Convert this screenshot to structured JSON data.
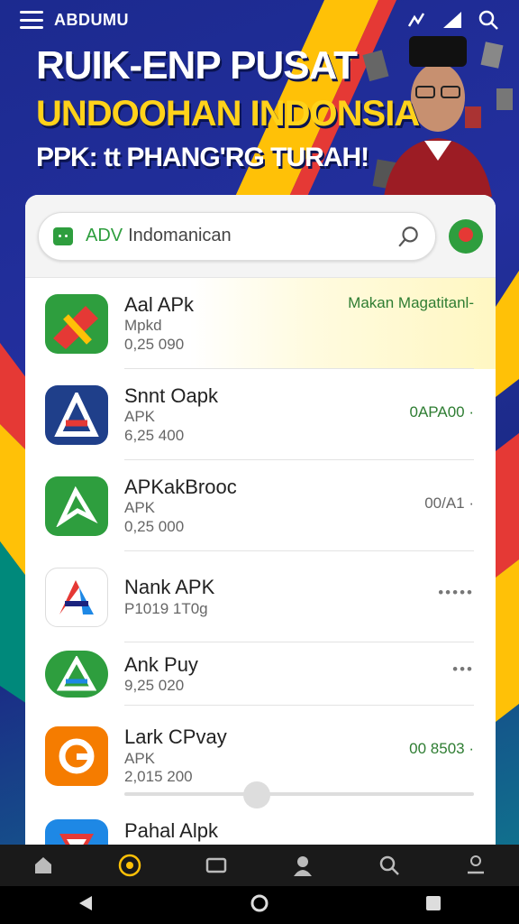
{
  "header": {
    "brand": "ABDUMU",
    "headline_1": "RUIK-ENP PUSAT",
    "headline_2": "UNDOOHAN INDONSIA",
    "headline_3": "PPK: tt PHANG'RG TURAH!"
  },
  "search": {
    "prefix": "ADV",
    "value": "Indomanican"
  },
  "apps": [
    {
      "name": "Aal APk",
      "sub": "Mpkd",
      "meta": "0,25  090",
      "right": "Makan Magatitanl-",
      "icon": "green-red-ribbon-icon",
      "highlight": true
    },
    {
      "name": "Snnt Oapk",
      "sub": "APK",
      "meta": "6,25  400",
      "right": "0APA00 ·",
      "icon": "blue-a-icon"
    },
    {
      "name": "APKakBrooc",
      "sub": "APK",
      "meta": "0,25  000",
      "right": "00/A1 ·",
      "icon": "green-leaf-icon"
    },
    {
      "name": "Nank APK",
      "sub": "P1019  1T0g",
      "meta": "",
      "right": "•••••",
      "icon": "colorful-a-icon"
    },
    {
      "name": "Ank Puy",
      "sub": "9,25  020",
      "meta": "",
      "right": "•••",
      "icon": "green-triangle-icon"
    },
    {
      "name": "Lark CPvay",
      "sub": "APK",
      "meta": "2,015  200",
      "right": "00 8503 ·",
      "icon": "orange-g-icon"
    },
    {
      "name": "Pahal Alpk",
      "sub": "",
      "meta": "",
      "right": "",
      "icon": "blue-red-arrow-icon"
    }
  ],
  "colors": {
    "accent": "#2e9e3e",
    "brand_blue": "#1c2a8f",
    "yellow": "#ffd21a"
  }
}
